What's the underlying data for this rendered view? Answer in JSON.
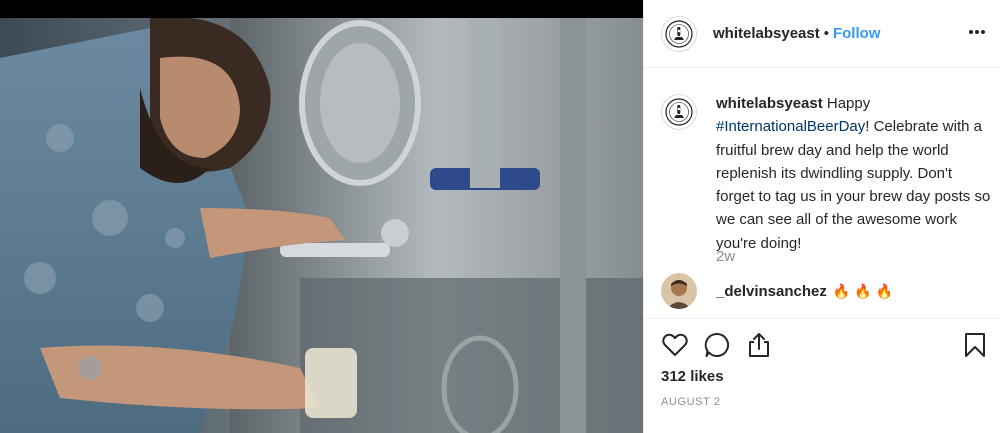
{
  "post": {
    "photo_description": "Man pouring beer from stainless steel fermentation tank",
    "header": {
      "username": "whitelabsyeast",
      "separator": "•",
      "follow_label": "Follow"
    },
    "caption": {
      "username": "whitelabsyeast",
      "text_before": " Happy ",
      "hashtag": "#InternationalBeerDay",
      "text_after": "! Celebrate with a fruitful brew day and help the world replenish its dwindling supply. Don't forget to tag us in your brew day posts so we can see all of the awesome work you're doing!",
      "time": "2w"
    },
    "comment": {
      "username": "_delvinsanchez",
      "text": "🔥 🔥 🔥"
    },
    "likes": "312 likes",
    "date": "AUGUST 2"
  },
  "icons": {
    "more": "more-options-icon",
    "like": "heart-icon",
    "comment": "comment-icon",
    "share": "share-icon",
    "save": "bookmark-icon"
  },
  "colors": {
    "follow": "#3897f0",
    "hashtag": "#003569",
    "muted": "#8e8e8e",
    "text": "#262626",
    "border": "#efefef"
  }
}
